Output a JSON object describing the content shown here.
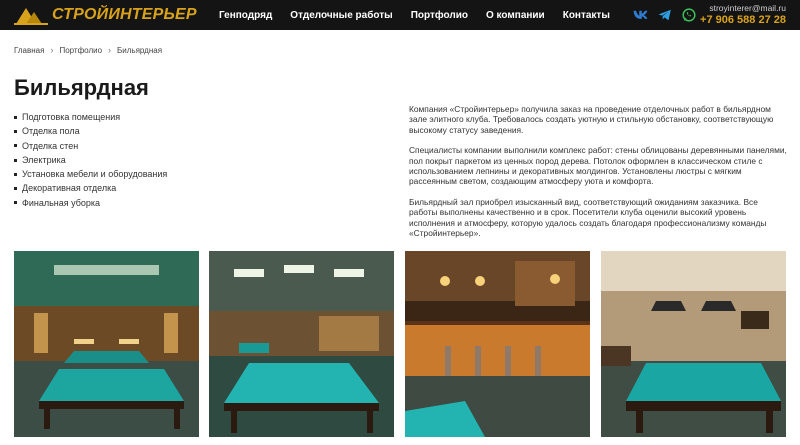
{
  "header": {
    "logo_text": "СТРОЙИНТЕРЬЕР",
    "nav": [
      "Генподряд",
      "Отделочные работы",
      "Портфолио",
      "О компании",
      "Контакты"
    ],
    "socials": [
      "vk-icon",
      "telegram-icon",
      "whatsapp-icon"
    ],
    "email": "stroyinterer@mail.ru",
    "phone": "+7 906 588 27 28",
    "accent_color": "#d9a21b",
    "background_color": "#141414"
  },
  "breadcrumb": [
    "Главная",
    "Портфолио",
    "Бильярдная"
  ],
  "page_title": "Бильярдная",
  "work_items": [
    "Подготовка помещения",
    "Отделка пола",
    "Отделка стен",
    "Электрика",
    "Установка мебели и оборудования",
    "Декоративная отделка",
    "Финальная уборка"
  ],
  "description": [
    "Компания «Стройинтерьер» получила заказ на проведение отделочных работ в бильярдном зале элитного клуба. Требовалось создать уютную и стильную обстановку, соответствующую высокому статусу заведения.",
    "Специалисты компании выполнили комплекс работ: стены облицованы деревянными панелями, пол покрыт паркетом из ценных пород дерева. Потолок оформлен в классическом стиле с использованием лепнины и декоративных молдингов. Установлены люстры с мягким рассеянным светом, создающим атмосферу уюта и комфорта.",
    "Бильярдный зал приобрел изысканный вид, соответствующий ожиданиям заказчика. Все работы выполнены качественно и в срок. Посетители клуба оценили высокий уровень исполнения и атмосферу, которую удалось создать благодаря профессионализму команды «Стройинтерьер»."
  ],
  "gallery": [
    {
      "name": "billiard-hall-photo-1"
    },
    {
      "name": "billiard-hall-photo-2"
    },
    {
      "name": "billiard-bar-photo"
    },
    {
      "name": "billiard-table-photo"
    }
  ]
}
